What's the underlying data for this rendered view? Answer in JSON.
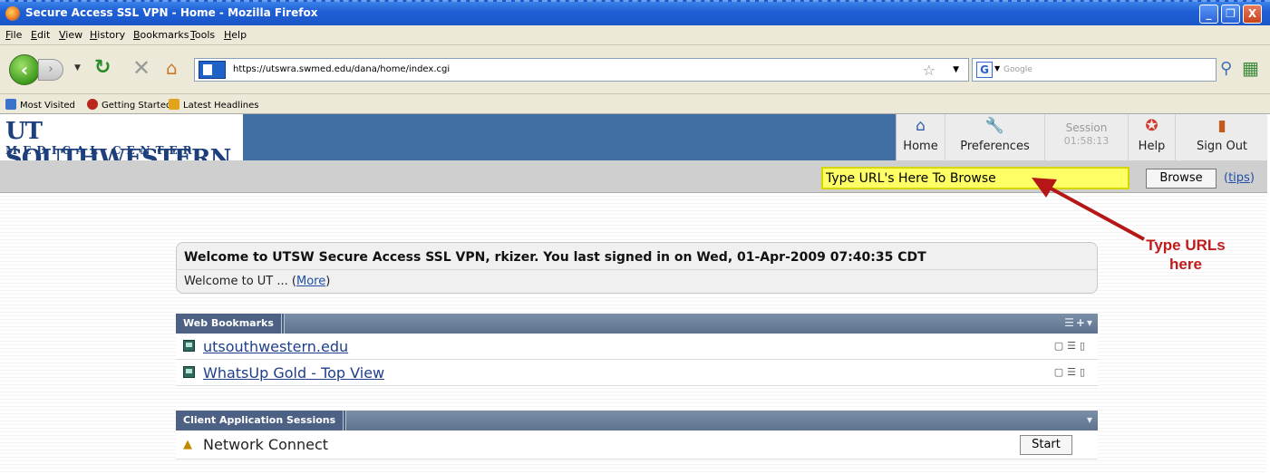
{
  "window": {
    "title": "Secure Access SSL VPN - Home - Mozilla Firefox",
    "minimize": "_",
    "maximize": "❐",
    "close": "X"
  },
  "menu": [
    "File",
    "Edit",
    "View",
    "History",
    "Bookmarks",
    "Tools",
    "Help"
  ],
  "nav": {
    "url": "https://utswra.swmed.edu/dana/home/index.cgi",
    "search_placeholder": "Google"
  },
  "bookmarks_bar": [
    "Most Visited",
    "Getting Started",
    "Latest Headlines"
  ],
  "site": {
    "logo_line1": "UT SOUTHWESTERN",
    "logo_line2": "MEDICAL CENTER",
    "toolbar": {
      "home": "Home",
      "preferences": "Preferences",
      "session_label": "Session",
      "session_time": "01:58:13",
      "help": "Help",
      "signout": "Sign Out"
    },
    "url_input_value": "Type URL's Here To Browse",
    "browse_button": "Browse",
    "tips_link": "tips",
    "annotation": "Type URLs here"
  },
  "welcome": {
    "line1": "Welcome to UTSW Secure Access SSL VPN, rkizer.  You last signed in on  Wed, 01-Apr-2009 07:40:35 CDT",
    "line2": "Welcome to UT ... ",
    "more_link": "More"
  },
  "web_bookmarks": {
    "title": "Web Bookmarks",
    "items": [
      {
        "label": "utsouthwestern.edu"
      },
      {
        "label": "WhatsUp Gold - Top View"
      }
    ]
  },
  "client_apps": {
    "title": "Client Application Sessions",
    "items": [
      {
        "label": "Network Connect",
        "button": "Start"
      }
    ]
  },
  "colors": {
    "header_band": "#3f6fa3",
    "url_highlight": "#ffff66",
    "annotation": "#c11b1b"
  }
}
